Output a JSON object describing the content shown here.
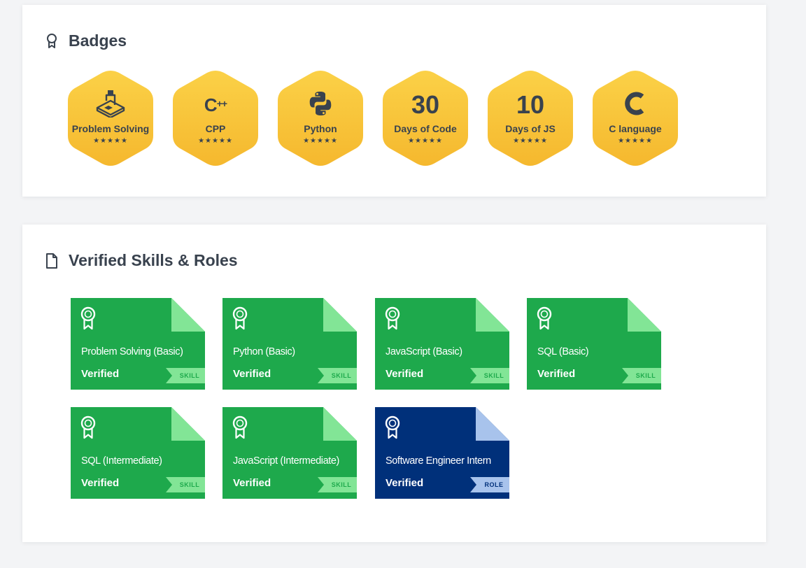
{
  "badges_section": {
    "title": "Badges",
    "icon": "award-icon",
    "badges": [
      {
        "label": "Problem Solving",
        "glyph": "",
        "icon": "problem-solving-icon",
        "stars": "★★★★★"
      },
      {
        "label": "CPP",
        "glyph": "C++",
        "icon": "cpp-icon",
        "stars": "★★★★★"
      },
      {
        "label": "Python",
        "glyph": "",
        "icon": "python-icon",
        "stars": "★★★★★"
      },
      {
        "label": "Days of Code",
        "glyph": "30",
        "icon": "days-of-code-icon",
        "stars": "★★★★★"
      },
      {
        "label": "Days of JS",
        "glyph": "10",
        "icon": "days-of-js-icon",
        "stars": "★★★★★"
      },
      {
        "label": "C language",
        "glyph": "C",
        "icon": "c-language-icon",
        "stars": "★★★★★"
      }
    ],
    "badge_color_top": "#fbd147",
    "badge_color_bottom": "#f5b82e"
  },
  "skills_section": {
    "title": "Verified Skills & Roles",
    "icon": "document-icon",
    "skills": [
      {
        "title": "Problem Solving (Basic)",
        "status": "Verified",
        "tag": "SKILL",
        "kind": "skill"
      },
      {
        "title": "Python (Basic)",
        "status": "Verified",
        "tag": "SKILL",
        "kind": "skill"
      },
      {
        "title": "JavaScript (Basic)",
        "status": "Verified",
        "tag": "SKILL",
        "kind": "skill"
      },
      {
        "title": "SQL (Basic)",
        "status": "Verified",
        "tag": "SKILL",
        "kind": "skill"
      },
      {
        "title": "SQL (Intermediate)",
        "status": "Verified",
        "tag": "SKILL",
        "kind": "skill"
      },
      {
        "title": "JavaScript (Intermediate)",
        "status": "Verified",
        "tag": "SKILL",
        "kind": "skill"
      },
      {
        "title": "Software Engineer Intern",
        "status": "Verified",
        "tag": "ROLE",
        "kind": "role"
      }
    ],
    "colors": {
      "skill": "#1ea94c",
      "skill_light": "#82e596",
      "role": "#00307a",
      "role_light": "#a8c3ec"
    }
  }
}
